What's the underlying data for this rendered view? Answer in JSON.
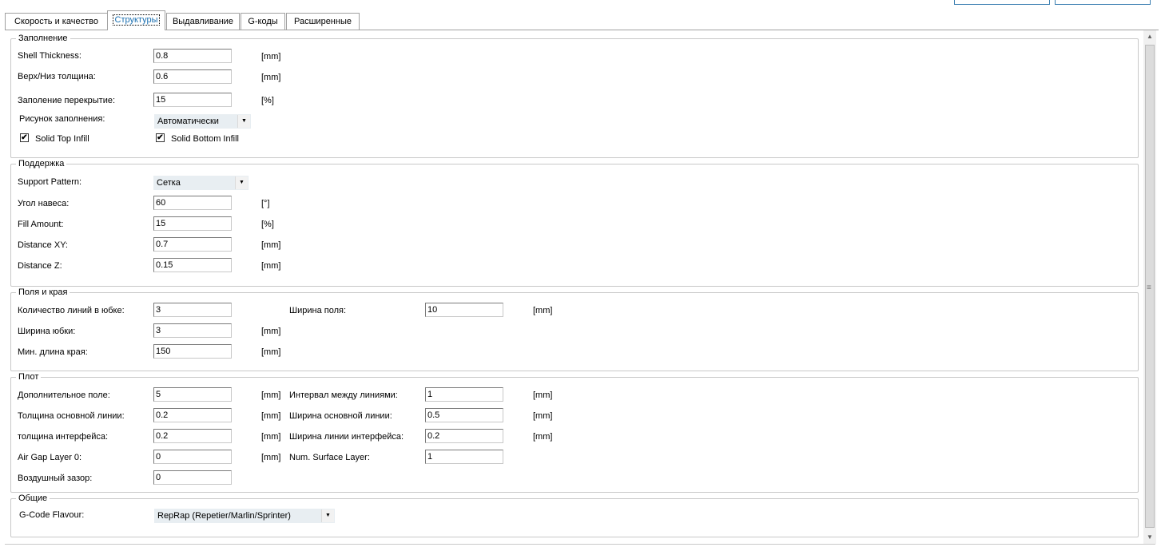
{
  "tabs": [
    {
      "label": "Скорость и качество"
    },
    {
      "label": "Структуры",
      "active": true
    },
    {
      "label": "Выдавливание"
    },
    {
      "label": "G-коды"
    },
    {
      "label": "Расширенные"
    }
  ],
  "infill": {
    "title": "Заполнение",
    "shell_thickness": {
      "label": "Shell Thickness:",
      "value": "0.8",
      "unit": "[mm]"
    },
    "top_bottom": {
      "label": "Верх/Низ толщина:",
      "value": "0.6",
      "unit": "[mm]"
    },
    "overlap": {
      "label": "Заполение перекрытие:",
      "value": "15",
      "unit": "[%]"
    },
    "pattern": {
      "label": "Рисунок заполнения:",
      "value": "Автоматически"
    },
    "solid_top": {
      "label": "Solid Top Infill",
      "checked": true
    },
    "solid_bottom": {
      "label": "Solid Bottom Infill",
      "checked": true
    }
  },
  "support": {
    "title": "Поддержка",
    "pattern": {
      "label": "Support Pattern:",
      "value": "Сетка"
    },
    "angle": {
      "label": "Угол навеса:",
      "value": "60",
      "unit": "[°]"
    },
    "fill": {
      "label": "Fill Amount:",
      "value": "15",
      "unit": "[%]"
    },
    "dist_xy": {
      "label": "Distance XY:",
      "value": "0.7",
      "unit": "[mm]"
    },
    "dist_z": {
      "label": "Distance Z:",
      "value": "0.15",
      "unit": "[mm]"
    }
  },
  "skirt": {
    "title": "Поля и края",
    "lines": {
      "label": "Количество линий в юбке:",
      "value": "3"
    },
    "brim_width": {
      "label": "Ширина поля:",
      "value": "10",
      "unit": "[mm]"
    },
    "skirt_width": {
      "label": "Ширина юбки:",
      "value": "3",
      "unit": "[mm]"
    },
    "min_length": {
      "label": "Мин. длина края:",
      "value": "150",
      "unit": "[mm]"
    }
  },
  "raft": {
    "title": "Плот",
    "extra_margin": {
      "label": "Дополнительное поле:",
      "value": "5",
      "unit": "[mm]"
    },
    "line_spacing": {
      "label": "Интервал между линиями:",
      "value": "1",
      "unit": "[mm]"
    },
    "base_thickness": {
      "label": "Толщина основной линии:",
      "value": "0.2",
      "unit": "[mm]"
    },
    "base_width": {
      "label": "Ширина основной линии:",
      "value": "0.5",
      "unit": "[mm]"
    },
    "interface_thickness": {
      "label": "толщина интерфейса:",
      "value": "0.2",
      "unit": "[mm]"
    },
    "interface_width": {
      "label": "Ширина линии интерфейса:",
      "value": "0.2",
      "unit": "[mm]"
    },
    "air_gap_0": {
      "label": "Air Gap Layer 0:",
      "value": "0",
      "unit": "[mm]"
    },
    "surface_layers": {
      "label": "Num. Surface Layer:",
      "value": "1"
    },
    "air_gap": {
      "label": "Воздушный зазор:",
      "value": "0"
    }
  },
  "general": {
    "title": "Общие",
    "flavour": {
      "label": "G-Code Flavour:",
      "value": "RepRap (Repetier/Marlin/Sprinter)"
    }
  },
  "icons": {
    "dropdown": "▼",
    "check": "✔",
    "scroll_up": "▲",
    "scroll_down": "▼",
    "grip": "≡"
  }
}
